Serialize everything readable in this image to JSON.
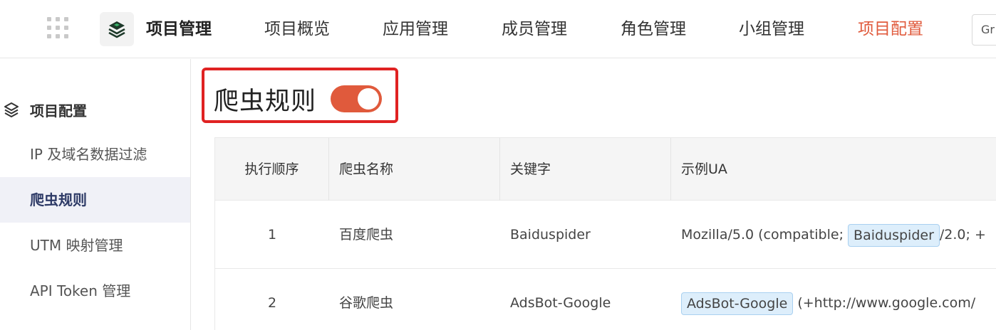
{
  "topnav": {
    "brand": "项目管理",
    "items": [
      {
        "label": "项目概览"
      },
      {
        "label": "应用管理"
      },
      {
        "label": "成员管理"
      },
      {
        "label": "角色管理"
      },
      {
        "label": "小组管理"
      },
      {
        "label": "项目配置",
        "active": true
      }
    ],
    "search_text": "Gr"
  },
  "sidebar": {
    "section_title": "项目配置",
    "items": [
      {
        "label": "IP 及域名数据过滤"
      },
      {
        "label": "爬虫规则",
        "active": true
      },
      {
        "label": "UTM 映射管理"
      },
      {
        "label": "API Token 管理"
      }
    ]
  },
  "page": {
    "title": "爬虫规则",
    "toggle_on": true
  },
  "table": {
    "headers": [
      "执行顺序",
      "爬虫名称",
      "关键字",
      "示例UA"
    ],
    "rows": [
      {
        "order": "1",
        "name": "百度爬虫",
        "keyword": "Baiduspider",
        "ua_prefix": "Mozilla/5.0 (compatible; ",
        "ua_tag": "Baiduspider",
        "ua_suffix": "/2.0; +"
      },
      {
        "order": "2",
        "name": "谷歌爬虫",
        "keyword": "AdsBot-Google",
        "ua_prefix": "",
        "ua_tag": "AdsBot-Google",
        "ua_suffix": " (+http://www.google.com/"
      }
    ]
  },
  "colors": {
    "accent": "#e05a3c",
    "highlight_border": "#e02222",
    "tag_bg": "#ddeefb",
    "sidebar_active_bg": "#f0f1f7"
  }
}
